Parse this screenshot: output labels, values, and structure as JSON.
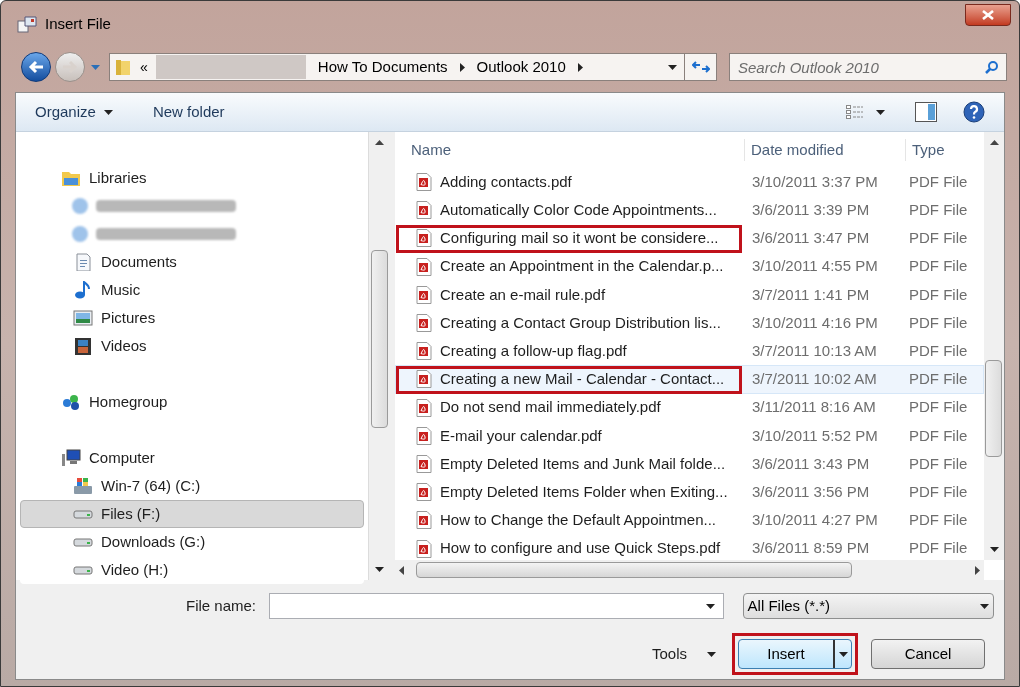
{
  "window": {
    "title": "Insert File"
  },
  "address_bar": {
    "segments": [
      "«",
      "How To Documents",
      "Outlook 2010"
    ]
  },
  "search": {
    "placeholder": "Search Outlook 2010"
  },
  "toolbar": {
    "organize": "Organize",
    "new_folder": "New folder"
  },
  "sidebar": {
    "items": [
      {
        "kind": "libraries",
        "label": "Libraries",
        "selected": false,
        "children": [
          {
            "kind": "redacted"
          },
          {
            "kind": "redacted"
          },
          {
            "kind": "documents",
            "label": "Documents",
            "selected": false
          },
          {
            "kind": "music",
            "label": "Music",
            "selected": false
          },
          {
            "kind": "pictures",
            "label": "Pictures",
            "selected": false
          },
          {
            "kind": "videos",
            "label": "Videos",
            "selected": false
          }
        ]
      },
      {
        "kind": "homegroup",
        "label": "Homegroup",
        "selected": false
      },
      {
        "kind": "computer",
        "label": "Computer",
        "selected": false,
        "children": [
          {
            "kind": "system-drive",
            "label": "Win-7 (64) (C:)",
            "selected": false
          },
          {
            "kind": "drive",
            "label": "Files (F:)",
            "selected": true
          },
          {
            "kind": "drive",
            "label": "Downloads (G:)",
            "selected": false
          },
          {
            "kind": "drive",
            "label": "Video (H:)",
            "selected": false
          }
        ]
      }
    ]
  },
  "table": {
    "columns": [
      "Name",
      "Date modified",
      "Type"
    ],
    "rows": [
      {
        "name": "Adding contacts.pdf",
        "date": "3/10/2011 3:37 PM",
        "type": "PDF File",
        "selected": false,
        "highlighted": false
      },
      {
        "name": "Automatically Color Code Appointments...",
        "date": "3/6/2011 3:39 PM",
        "type": "PDF File",
        "selected": false,
        "highlighted": false
      },
      {
        "name": "Configuring mail so it wont be considere...",
        "date": "3/6/2011 3:47 PM",
        "type": "PDF File",
        "selected": false,
        "highlighted": true
      },
      {
        "name": "Create an Appointment in the Calendar.p...",
        "date": "3/10/2011 4:55 PM",
        "type": "PDF File",
        "selected": false,
        "highlighted": false
      },
      {
        "name": "Create an e-mail rule.pdf",
        "date": "3/7/2011 1:41 PM",
        "type": "PDF File",
        "selected": false,
        "highlighted": false
      },
      {
        "name": "Creating a Contact Group Distribution lis...",
        "date": "3/10/2011 4:16 PM",
        "type": "PDF File",
        "selected": false,
        "highlighted": false
      },
      {
        "name": "Creating a follow-up flag.pdf",
        "date": "3/7/2011 10:13 AM",
        "type": "PDF File",
        "selected": false,
        "highlighted": false
      },
      {
        "name": "Creating a new Mail - Calendar - Contact...",
        "date": "3/7/2011 10:02 AM",
        "type": "PDF File",
        "selected": true,
        "highlighted": true
      },
      {
        "name": "Do not send mail immediately.pdf",
        "date": "3/11/2011 8:16 AM",
        "type": "PDF File",
        "selected": false,
        "highlighted": false
      },
      {
        "name": "E-mail your calendar.pdf",
        "date": "3/10/2011 5:52 PM",
        "type": "PDF File",
        "selected": false,
        "highlighted": false
      },
      {
        "name": "Empty Deleted Items and Junk Mail folde...",
        "date": "3/6/2011 3:43 PM",
        "type": "PDF File",
        "selected": false,
        "highlighted": false
      },
      {
        "name": "Empty Deleted Items Folder when Exiting...",
        "date": "3/6/2011 3:56 PM",
        "type": "PDF File",
        "selected": false,
        "highlighted": false
      },
      {
        "name": "How to Change the Default Appointmen...",
        "date": "3/10/2011 4:27 PM",
        "type": "PDF File",
        "selected": false,
        "highlighted": false
      },
      {
        "name": "How to configure and use Quick Steps.pdf",
        "date": "3/6/2011 8:59 PM",
        "type": "PDF File",
        "selected": false,
        "highlighted": false
      }
    ]
  },
  "file_name": {
    "label": "File name:"
  },
  "filter": {
    "value": "All Files (*.*)"
  },
  "tools": "Tools",
  "buttons": [
    {
      "label": "Insert",
      "kind": "split",
      "highlighted": true
    },
    {
      "label": "Cancel",
      "kind": "plain",
      "highlighted": false
    }
  ]
}
